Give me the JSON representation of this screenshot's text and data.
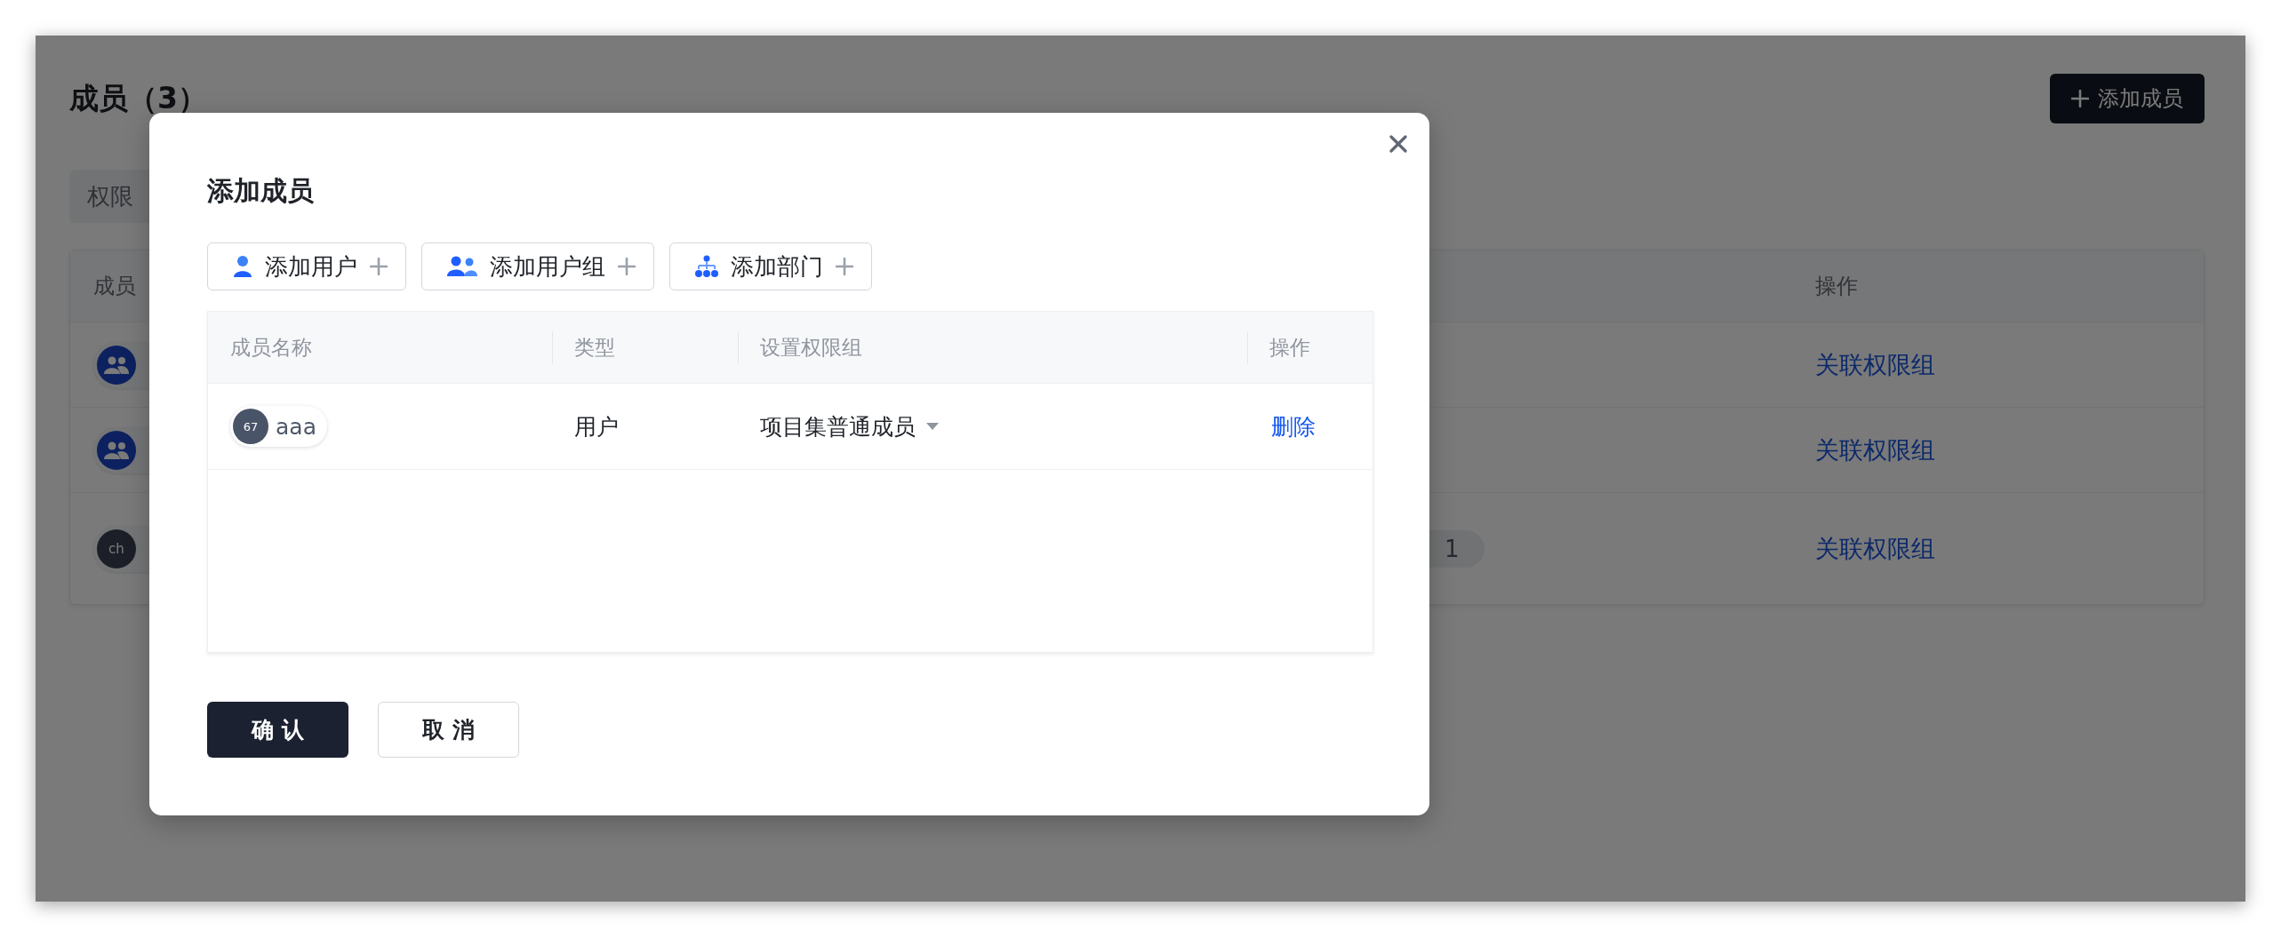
{
  "page": {
    "title": "成员（3）",
    "add_button": "添加成员",
    "filter_chip": "权限",
    "table": {
      "columns": [
        "成员",
        "操作"
      ],
      "rows": [
        {
          "avatar": {
            "kind": "group"
          },
          "action": "关联权限组"
        },
        {
          "avatar": {
            "kind": "group"
          },
          "action": "关联权限组"
        },
        {
          "avatar": {
            "kind": "initials",
            "initials": "ch"
          },
          "count": "1",
          "action": "关联权限组"
        }
      ]
    }
  },
  "dialog": {
    "title": "添加成员",
    "add_buttons": [
      {
        "kind": "user",
        "label": "添加用户"
      },
      {
        "kind": "group",
        "label": "添加用户组"
      },
      {
        "kind": "department",
        "label": "添加部门"
      }
    ],
    "table": {
      "columns": [
        "成员名称",
        "类型",
        "设置权限组",
        "操作"
      ],
      "rows": [
        {
          "avatar": "67",
          "name": "aaa",
          "type": "用户",
          "permission_group": "项目集普通成员",
          "action": "删除"
        }
      ]
    },
    "buttons": [
      {
        "kind": "primary",
        "label": "确 认"
      },
      {
        "kind": "secondary",
        "label": "取 消"
      }
    ]
  }
}
